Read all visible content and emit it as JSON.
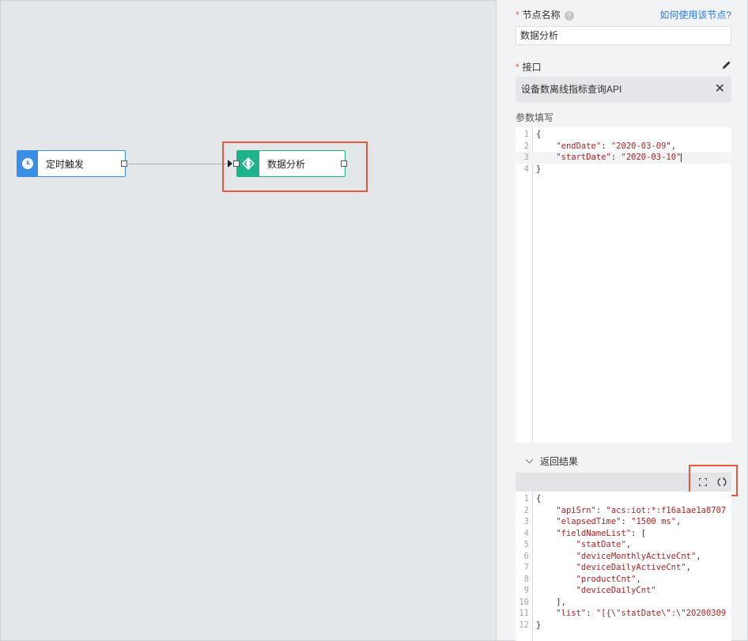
{
  "canvas": {
    "nodes": [
      {
        "id": "timer",
        "label": "定时触发",
        "icon": "clock-icon",
        "color": "#3a8ee6"
      },
      {
        "id": "analysis",
        "label": "数据分析",
        "icon": "code-diamond-icon",
        "color": "#1fb38c"
      }
    ],
    "highlight_color": "#e5573f"
  },
  "panel": {
    "node_name_label": "节点名称",
    "help_mark": "?",
    "help_link": "如何使用该节点?",
    "node_name_value": "数据分析",
    "interface_label": "接口",
    "interface_value": "设备数离线指标查询API",
    "close_mark": "✕",
    "params_label": "参数填写",
    "params_lines": [
      {
        "num": "1",
        "text": "{"
      },
      {
        "num": "2",
        "text": "    \"endDate\": \"2020-03-09\","
      },
      {
        "num": "3",
        "text": "    \"startDate\": \"2020-03-10\""
      },
      {
        "num": "4",
        "text": "}"
      }
    ],
    "result_label": "返回结果",
    "result_lines": [
      {
        "num": "1",
        "text": "{"
      },
      {
        "num": "2",
        "text": "    \"apiSrn\": \"acs:iot:*:f16a1ae1a8707"
      },
      {
        "num": "3",
        "text": "    \"elapsedTime\": \"1500 ms\","
      },
      {
        "num": "4",
        "text": "    \"fieldNameList\": ["
      },
      {
        "num": "5",
        "text": "        \"statDate\","
      },
      {
        "num": "6",
        "text": "        \"deviceMonthlyActiveCnt\","
      },
      {
        "num": "7",
        "text": "        \"deviceDailyActiveCnt\","
      },
      {
        "num": "8",
        "text": "        \"productCnt\","
      },
      {
        "num": "9",
        "text": "        \"deviceDailyCnt\""
      },
      {
        "num": "10",
        "text": "    ],"
      },
      {
        "num": "11",
        "text": "    \"list\": \"[{\\\"statDate\\\":\\\"20200309"
      },
      {
        "num": "12",
        "text": "}"
      }
    ]
  }
}
